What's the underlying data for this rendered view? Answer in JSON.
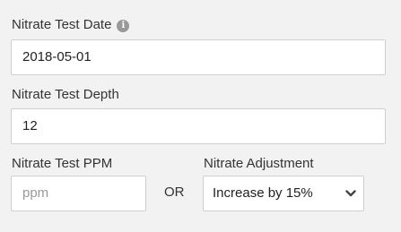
{
  "fields": {
    "test_date": {
      "label": "Nitrate Test Date",
      "value": "2018-05-01",
      "info_icon": "info-icon"
    },
    "test_depth": {
      "label": "Nitrate Test Depth",
      "value": "12"
    },
    "test_ppm": {
      "label": "Nitrate Test PPM",
      "placeholder": "ppm"
    },
    "separator": "OR",
    "adjustment": {
      "label": "Nitrate Adjustment",
      "selected": "Increase by 15%",
      "icon": "chevron-down-icon"
    }
  }
}
